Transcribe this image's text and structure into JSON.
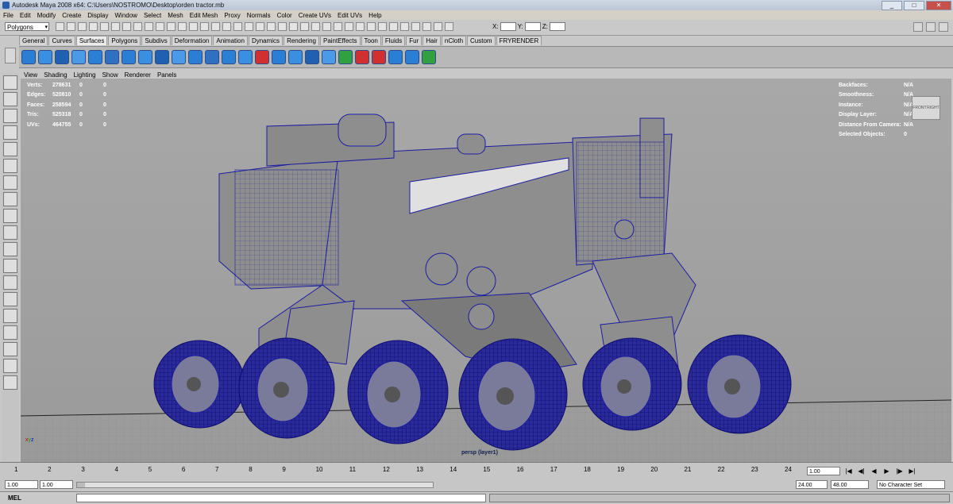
{
  "window": {
    "title": "Autodesk Maya 2008 x64: C:\\Users\\NOSTROMO\\Desktop\\orden tractor.mb",
    "minimize": "_",
    "maximize": "□",
    "close": "✕"
  },
  "menu": [
    "File",
    "Edit",
    "Modify",
    "Create",
    "Display",
    "Window",
    "Select",
    "Mesh",
    "Edit Mesh",
    "Proxy",
    "Normals",
    "Color",
    "Create UVs",
    "Edit UVs",
    "Help"
  ],
  "statusline": {
    "mode": "Polygons",
    "x_label": "X:",
    "y_label": "Y:",
    "z_label": "Z:"
  },
  "shelf_tabs": [
    "General",
    "Curves",
    "Surfaces",
    "Polygons",
    "Subdivs",
    "Deformation",
    "Animation",
    "Dynamics",
    "Rendering",
    "PaintEffects",
    "Toon",
    "Fluids",
    "Fur",
    "Hair",
    "nCloth",
    "Custom",
    "FRYRENDER"
  ],
  "shelf_active": "Surfaces",
  "panel_menu": [
    "View",
    "Shading",
    "Lighting",
    "Show",
    "Renderer",
    "Panels"
  ],
  "hud_left": [
    {
      "label": "Verts:",
      "v1": "278631",
      "v2": "0",
      "v3": "0"
    },
    {
      "label": "Edges:",
      "v1": "520810",
      "v2": "0",
      "v3": "0"
    },
    {
      "label": "Faces:",
      "v1": "258594",
      "v2": "0",
      "v3": "0"
    },
    {
      "label": "Tris:",
      "v1": "525318",
      "v2": "0",
      "v3": "0"
    },
    {
      "label": "UVs:",
      "v1": "464755",
      "v2": "0",
      "v3": "0"
    }
  ],
  "hud_right": [
    {
      "label": "Backfaces:",
      "value": "N/A"
    },
    {
      "label": "Smoothness:",
      "value": "N/A"
    },
    {
      "label": "Instance:",
      "value": "N/A"
    },
    {
      "label": "Display Layer:",
      "value": "N/A"
    },
    {
      "label": "Distance From Camera:",
      "value": "N/A"
    },
    {
      "label": "Selected Objects:",
      "value": "0"
    }
  ],
  "viewcube": {
    "left": "FRONT",
    "right": "RIGHT"
  },
  "camera_label": "persp (layer1)",
  "timeline": {
    "ticks": [
      "1",
      "2",
      "3",
      "4",
      "5",
      "6",
      "7",
      "8",
      "9",
      "10",
      "11",
      "12",
      "13",
      "14",
      "15",
      "16",
      "17",
      "18",
      "19",
      "20",
      "21",
      "22",
      "23",
      "24"
    ],
    "current_frame": "1.00"
  },
  "range": {
    "start": "1.00",
    "anim_start": "1.00",
    "anim_end": "24.00",
    "end": "48.00",
    "char_set": "No Character Set"
  },
  "command": {
    "label": "MEL"
  },
  "colors": {
    "wire": "#1c1ca0",
    "viewport": "#a3a3a3"
  }
}
